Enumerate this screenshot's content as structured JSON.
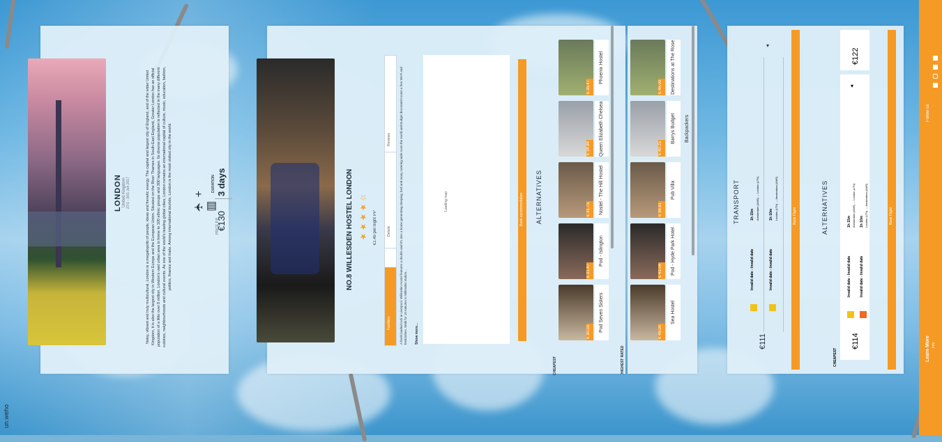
{
  "brand": "un.weho",
  "destination": {
    "city": "LONDON",
    "country": "United Kingdom",
    "dates": "27/1 - 30/1 Jan 2017",
    "description": "Noisy, vibrant and truly multicultural, London is a megalopolis of people, ideas and frenetic energy. The capital and largest city of England, and of the wider United Kingdom, it is also the largest city in Western Europe and the European Union. Situated on the River Thames in South-East England, Greater London has an official population of a little over 8 million. London's vast urban area is home to 100 ethnic groups and 300 languages. Its diverse population is reflected in the many different cuisines, neighbourhoods and cultural events. As one of the world's leading global cities, London remains an international capital of culture, music, education, fashion, politics, finance and trade. Among international tourists, London is the most visited city in the world.",
    "price_label": "PRICE P.P.",
    "price": "€130",
    "duration_label": "DURATION",
    "duration": "3 days"
  },
  "hostel": {
    "name": "NO.8 WILLESDEN HOSTEL LONDON",
    "price_pp": "€1.46 per night PP",
    "rating": 4,
    "tabs": [
      "Facilities",
      "Details",
      "Reviews"
    ],
    "description": "A fresh landed rock in Liverpool. Willesden Hostel features a double and it's also a home generating sleeping, bed and many catering wide room the world and Budget decorated rooms a free Wi-Fi and bedclothes. Walk for 10 minutes to Willesden station...",
    "show_more": "Show more...",
    "map_loading": "Loading map",
    "book_label": "Book accommodation",
    "alternatives_title": "ALTERNATIVES",
    "cheapest_label": "CHEAPEST",
    "highest_rated_label": "HIGHEST RATED",
    "cheapest": [
      {
        "name": "Pod Seven Sisters",
        "price": "€ 30.03"
      },
      {
        "name": "Pod - Islington",
        "price": "€ 31.47"
      },
      {
        "name": "Nostel - The Hill Hostel",
        "price": "€ 31.73"
      },
      {
        "name": "Queen Elizabeth Chelsea",
        "price": "€ 34.84"
      },
      {
        "name": "Phoenix Hostel",
        "price": "€ 35.47"
      }
    ],
    "highest_rated": [
      {
        "name": "Sea Hostel",
        "price": "€ 49.00"
      },
      {
        "name": "Pod - Hyde Park Hotel",
        "price": "€ 43.04"
      },
      {
        "name": "Pub Villa",
        "price": "€ 38.81"
      },
      {
        "name": "Barrys Budget Backpackers",
        "price": "€ 40.15"
      },
      {
        "name": "Destinations at The Rose",
        "price": "€ 45.00"
      }
    ]
  },
  "transport": {
    "title": "TRANSPORT",
    "price": "€111",
    "outbound_date": "Invalid date - Invalid date",
    "outbound_duration": "1h 15m",
    "outbound_route": "Amsterdam (AMS) → London (LTN)",
    "return_date": "Invalid date - Invalid date",
    "return_duration": "1h 10m",
    "return_route": "London (LTN) → Amsterdam (AMS)",
    "book_label": "Book Flight",
    "alternatives_title": "ALTERNATIVES",
    "cheapest_label": "CHEAPEST",
    "alt_price_a": "€114",
    "alt_price_b": "€122",
    "alt_outbound_date": "Invalid date - Invalid date",
    "alt_outbound_duration": "1h 15m",
    "alt_outbound_route": "Amsterdam (AMS) → London (LTN)",
    "alt_return_date": "Invalid date - Invalid date",
    "alt_return_duration": "1h 10m",
    "alt_return_route": "London (LTN) → Amsterdam (AMS)",
    "alt_book_label": "Book Flight"
  },
  "footer": {
    "learn_more": "Learn More",
    "learn_more_sub": "Info",
    "follow_us": "Follow us"
  }
}
